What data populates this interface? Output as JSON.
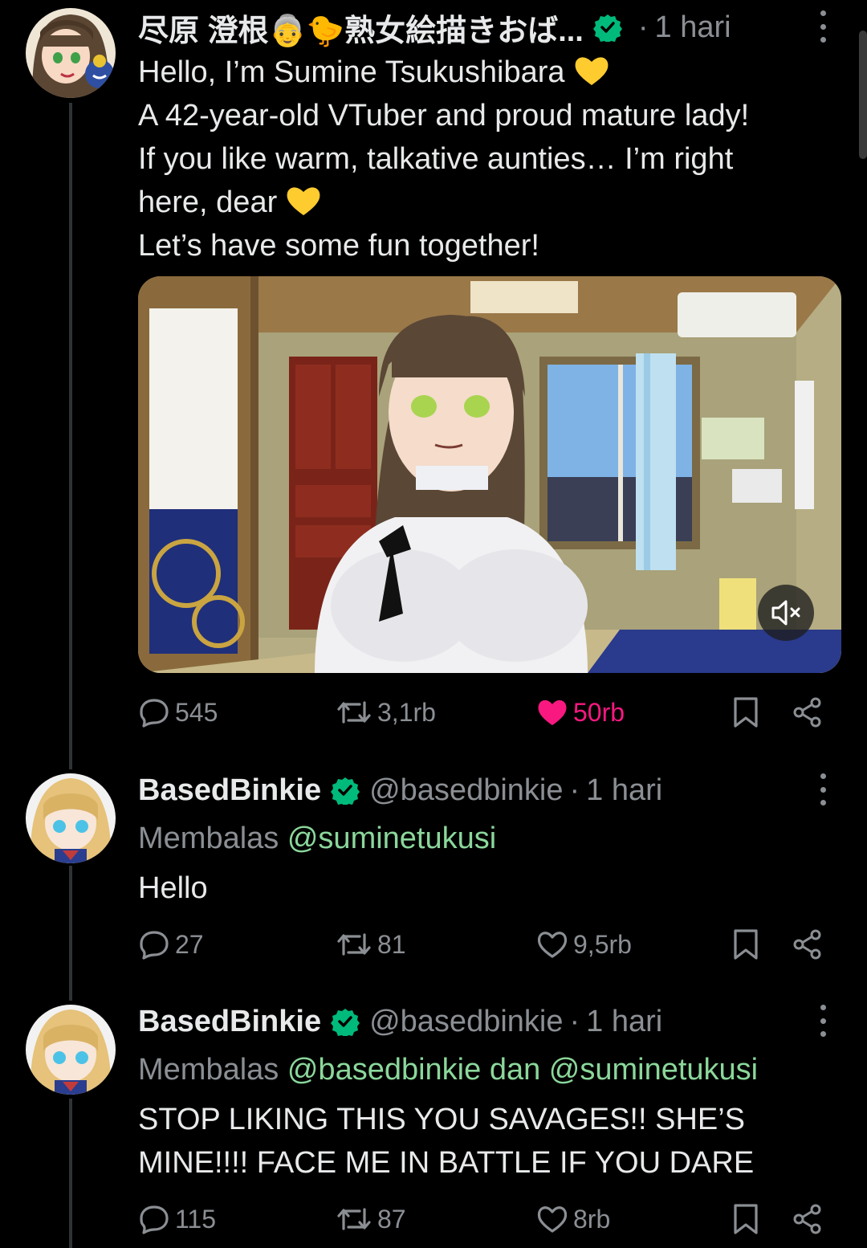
{
  "posts": [
    {
      "name": "尽原 澄根👵🐤熟女絵描きおば...",
      "time": "1 hari",
      "lines": [
        "Hello, I’m Sumine Tsukushibara",
        "A 42-year-old VTuber and proud mature lady!",
        "If you like warm, talkative aunties… I’m right",
        "here, dear",
        "Let’s have some fun together!"
      ],
      "stats": {
        "replies": "545",
        "reposts": "3,1rb",
        "likes": "50rb"
      }
    },
    {
      "name": "BasedBinkie",
      "handle": "@basedbinkie",
      "time": "1 hari",
      "reply_prefix": "Membalas",
      "reply_mentions": "@suminetukusi",
      "lines": [
        "Hello"
      ],
      "stats": {
        "replies": "27",
        "reposts": "81",
        "likes": "9,5rb"
      }
    },
    {
      "name": "BasedBinkie",
      "handle": "@basedbinkie",
      "time": "1 hari",
      "reply_prefix": "Membalas",
      "reply_mentions": "@basedbinkie dan @suminetukusi",
      "lines": [
        "STOP LIKING THIS YOU SAVAGES!!  SHE’S",
        "MINE!!!! FACE ME IN BATTLE IF YOU DARE"
      ],
      "stats": {
        "replies": "115",
        "reposts": "87",
        "likes": "8rb"
      }
    }
  ],
  "colors": {
    "background": "#000000",
    "text": "#e7e9ea",
    "secondary": "#8b8f94",
    "mention": "#8bd79b",
    "like_active": "#f91880",
    "verified": "#00ba7c"
  },
  "icons": [
    "verified-icon",
    "more-icon",
    "reply-icon",
    "repost-icon",
    "heart-icon",
    "bookmark-icon",
    "share-icon",
    "mute-icon"
  ]
}
